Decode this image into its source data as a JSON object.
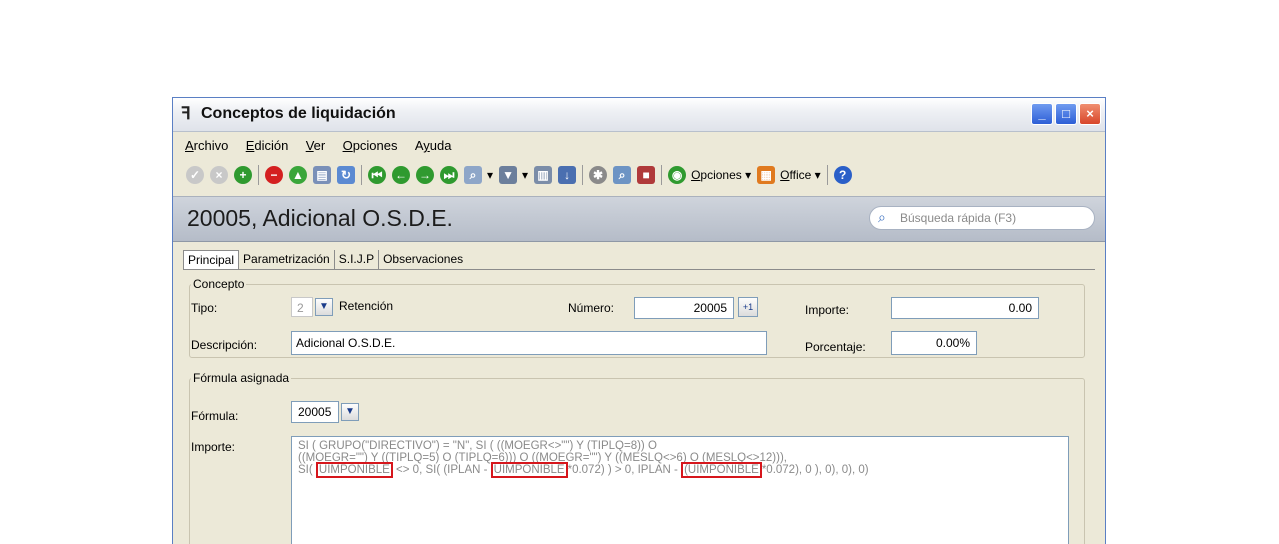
{
  "window": {
    "title": "Conceptos de liquidación",
    "controls": [
      "minimize",
      "maximize",
      "close"
    ]
  },
  "menu": [
    {
      "u": "A",
      "rest": "rchivo"
    },
    {
      "u": "E",
      "rest": "dición"
    },
    {
      "u": "V",
      "rest": "er"
    },
    {
      "u": "O",
      "rest": "pciones"
    },
    {
      "pre": "A",
      "u": "y",
      "rest": "uda"
    }
  ],
  "toolbar": {
    "opciones_u": "O",
    "opciones_rest": "pciones",
    "office_u": "O",
    "office_rest": "ffice",
    "dropdown_arrow": "▾"
  },
  "header": {
    "title": "20005, Adicional O.S.D.E.",
    "search_placeholder": "Búsqueda rápida (F3)"
  },
  "tabs": [
    "Principal",
    "Parametrización",
    "S.I.J.P",
    "Observaciones"
  ],
  "concepto": {
    "group_label": "Concepto",
    "tipo_label": "Tipo:",
    "tipo_value": "2",
    "tipo_text": "Retención",
    "numero_label": "Número:",
    "numero_value": "20005",
    "numero_button": "+1",
    "importe_label": "Importe:",
    "importe_value": "0.00",
    "descripcion_label": "Descripción:",
    "descripcion_value": "Adicional O.S.D.E.",
    "porcentaje_label": "Porcentaje:",
    "porcentaje_value": "0.00%"
  },
  "formula_group": {
    "group_label": "Fórmula asignada",
    "formula_label": "Fórmula:",
    "formula_value": "20005",
    "importe_label": "Importe:",
    "line1": "SI ( GRUPO(\"DIRECTIVO\") = \"N\", SI ( ((MOEGR<>\"\") Y (TIPLQ=8)) O",
    "line2": "((MOEGR=\"\") Y ((TIPLQ=5) O (TIPLQ=6))) O ((MOEGR=\"\") Y ((MESLQ<>6) O (MESLQ<>12))),",
    "line3_a": "SI(",
    "line3_hl1": "UIMPONIBLE",
    "line3_b": "<> 0, SI( (IPLAN -",
    "line3_hl2": "UIMPONIBLE",
    "line3_c": "*0.072) ) > 0, IPLAN -",
    "line3_hl3": "(UIMPONIBLE",
    "line3_d": "*0.072), 0 ), 0), 0), 0)"
  },
  "colors": {
    "accent_red": "#d6161c",
    "title_bar_buttons": "#2d5ed6"
  }
}
